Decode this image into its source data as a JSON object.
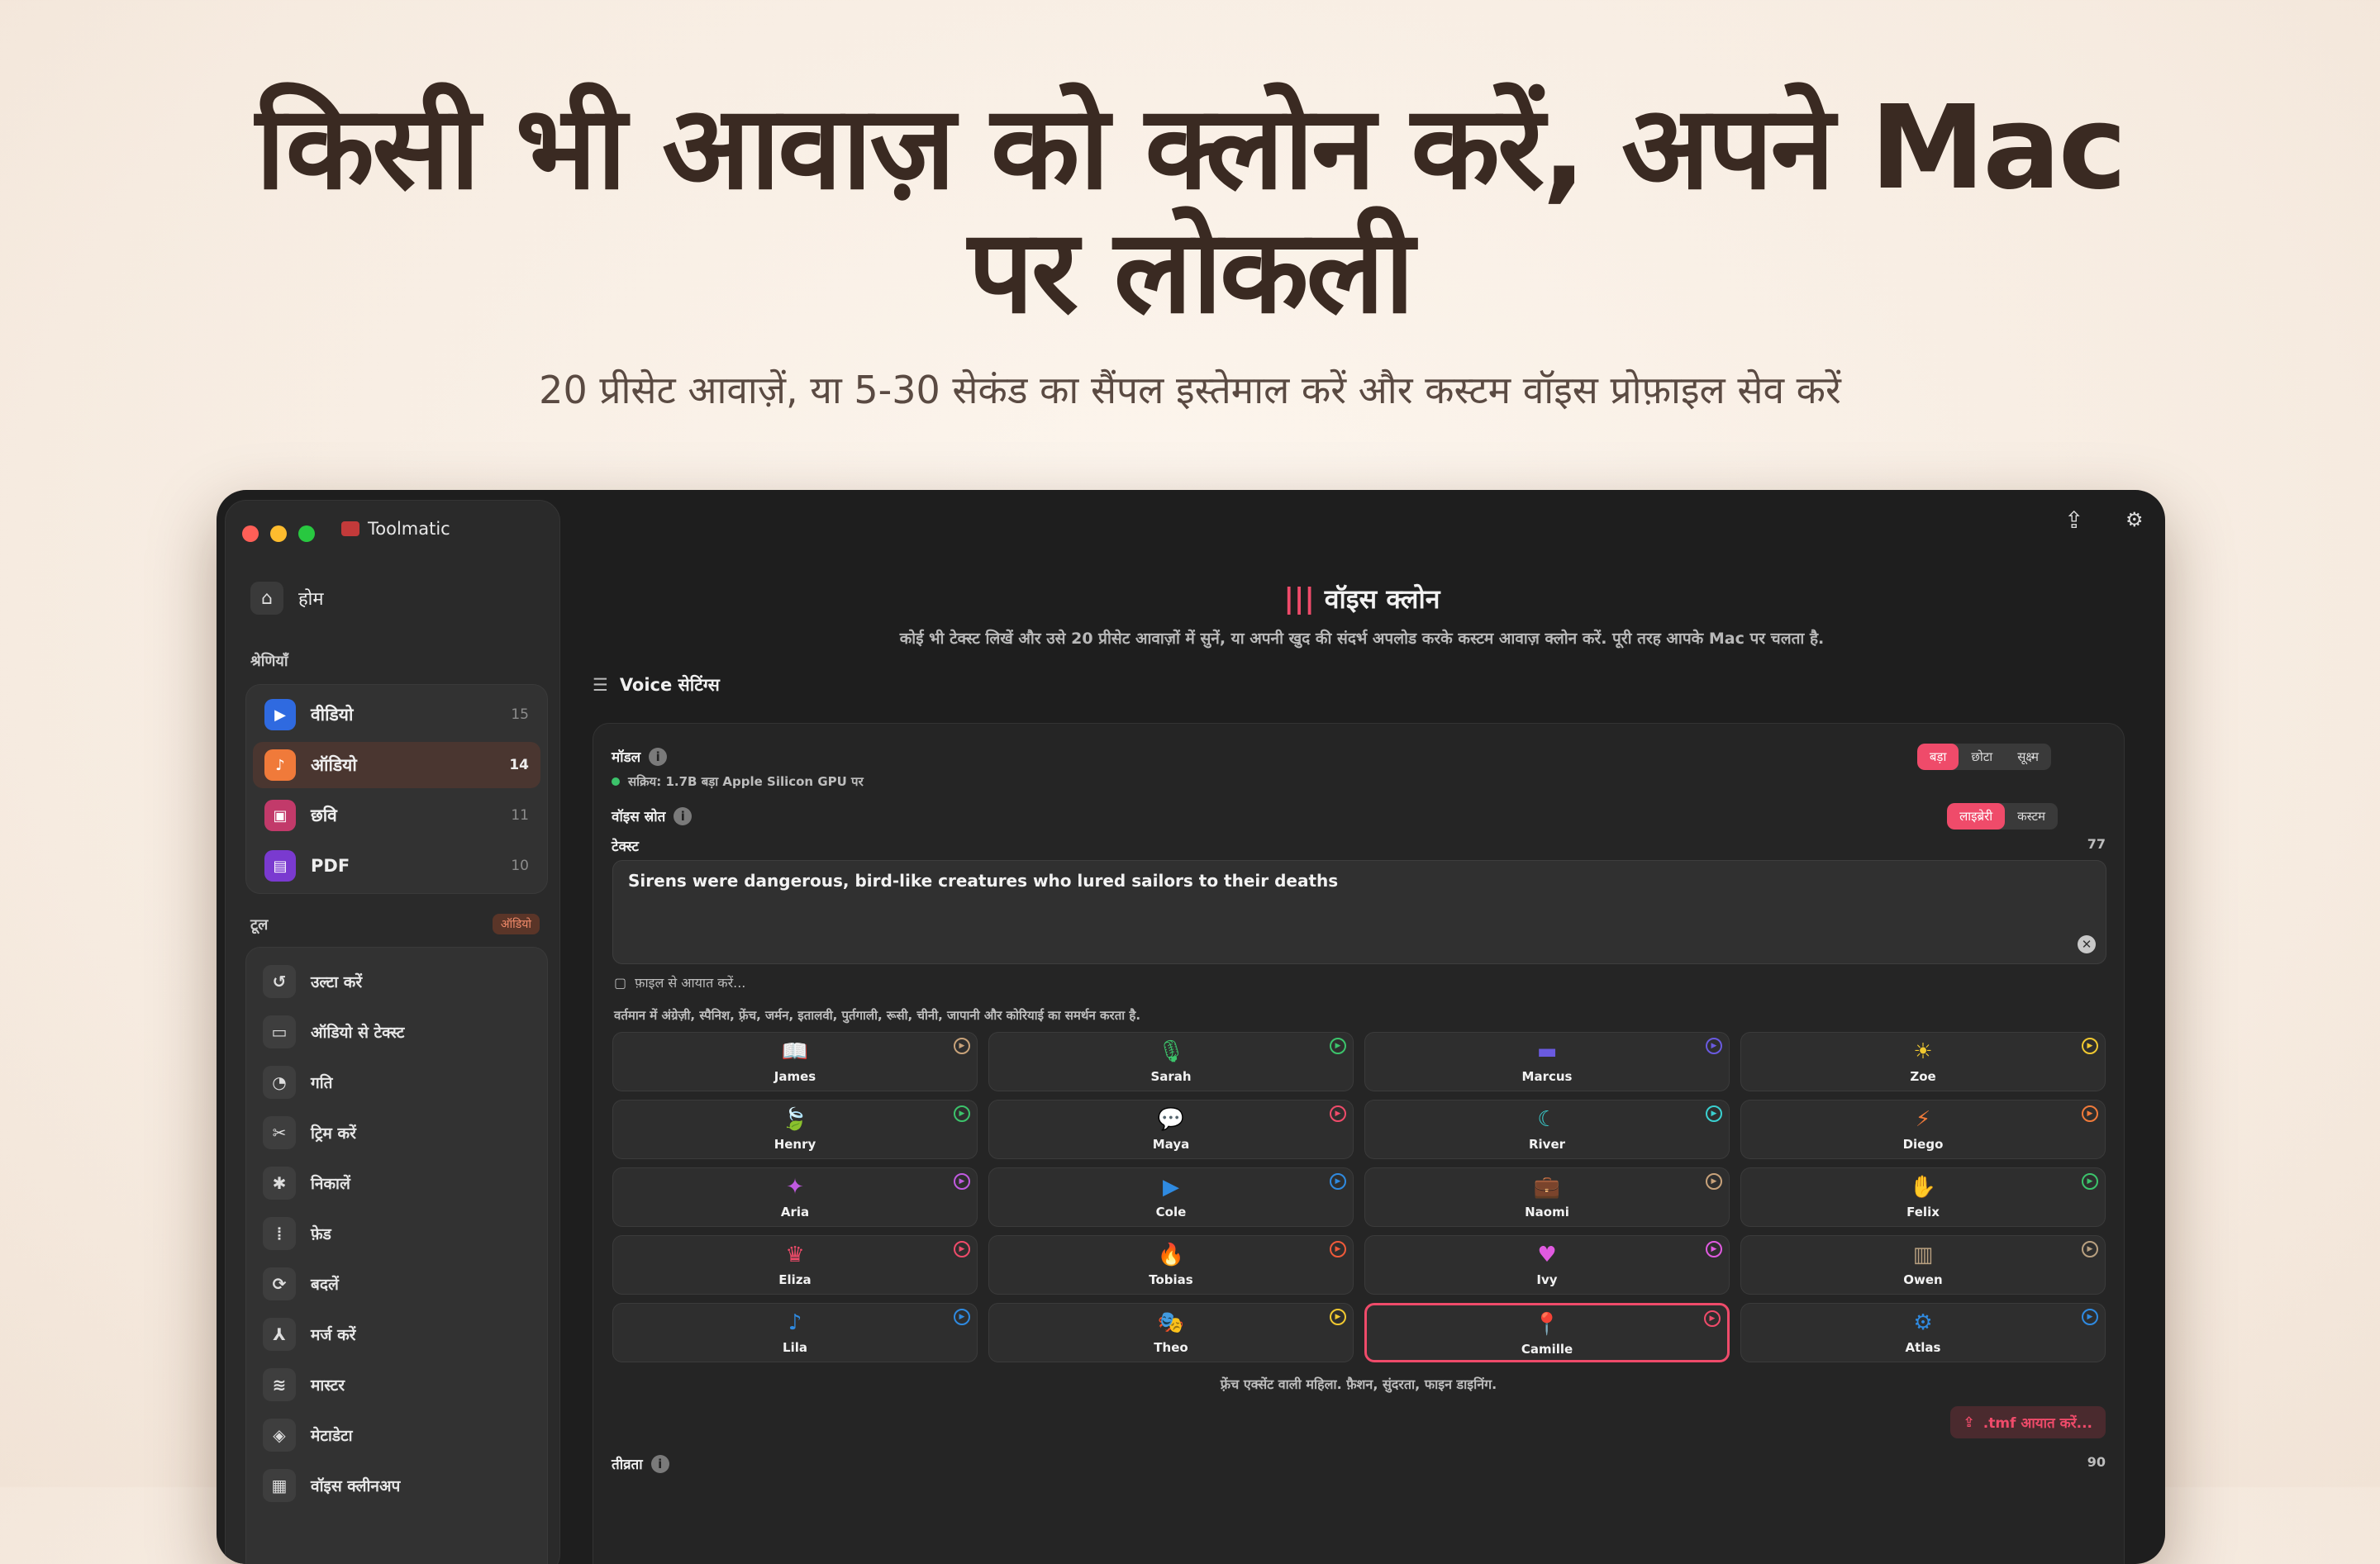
{
  "hero": {
    "title_line1": "किसी भी आवाज़ को क्लोन करें, अपने Mac",
    "title_line2": "पर लोकली",
    "subtitle": "20 प्रीसेट आवाज़ें, या 5-30 सेकंड का सैंपल इस्तेमाल करें और कस्टम वॉइस प्रोफ़ाइल सेव करें"
  },
  "app": {
    "title": "Toolmatic",
    "window_colors": {
      "close": "#ff5f57",
      "minimize": "#febc2e",
      "zoom": "#28c840"
    },
    "accent": "#ef4b6a"
  },
  "sidebar": {
    "home": "होम",
    "categories_label": "श्रेणियाँ",
    "categories": [
      {
        "label": "वीडियो",
        "count": "15",
        "icon": "video-icon",
        "color": "#2f6ae0"
      },
      {
        "label": "ऑडियो",
        "count": "14",
        "icon": "music-note-icon",
        "color": "#f07a3a"
      },
      {
        "label": "छवि",
        "count": "11",
        "icon": "image-icon",
        "color": "#c23a6a"
      },
      {
        "label": "PDF",
        "count": "10",
        "icon": "document-icon",
        "color": "#7a3ad0"
      }
    ],
    "tools_label": "टूल",
    "tools_badge": "ऑडियो",
    "tools": [
      {
        "label": "उल्टा करें",
        "icon": "undo-icon"
      },
      {
        "label": "ऑडियो से टेक्स्ट",
        "icon": "chat-bubble-icon"
      },
      {
        "label": "गति",
        "icon": "speedometer-icon"
      },
      {
        "label": "ट्रिम करें",
        "icon": "scissors-icon"
      },
      {
        "label": "निकालें",
        "icon": "waveform-extract-icon"
      },
      {
        "label": "फ़ेड",
        "icon": "waveform-fade-icon"
      },
      {
        "label": "बदलें",
        "icon": "convert-icon"
      },
      {
        "label": "मर्ज करें",
        "icon": "merge-icon"
      },
      {
        "label": "मास्टर",
        "icon": "master-icon"
      },
      {
        "label": "मेटाडेटा",
        "icon": "tag-icon"
      },
      {
        "label": "वॉइस क्लीनअप",
        "icon": "cleanup-icon"
      }
    ]
  },
  "main": {
    "title": "वॉइस क्लोन",
    "description": "कोई भी टेक्स्ट लिखें और उसे 20 प्रीसेट आवाज़ों में सुनें, या अपनी खुद की संदर्भ अपलोड करके कस्टम आवाज़ क्लोन करें. पूरी तरह आपके Mac पर चलता है.",
    "settings_title": "Voice सेटिंग्स",
    "model_label": "मॉडल",
    "model_status": "सक्रिय: 1.7B बड़ा Apple Silicon GPU पर",
    "model_options": [
      "बड़ा",
      "छोटा",
      "सूक्ष्म"
    ],
    "model_selected": "बड़ा",
    "source_label": "वॉइस स्रोत",
    "source_options": [
      "लाइब्रेरी",
      "कस्टम"
    ],
    "source_selected": "लाइब्रेरी",
    "text_label": "टेक्स्ट",
    "text_count": "77",
    "text_value": "Sirens were dangerous, bird-like creatures who lured sailors to their deaths",
    "import_file": "फ़ाइल से आयात करें...",
    "support_note": "वर्तमान में अंग्रेज़ी, स्पैनिश, फ़्रेंच, जर्मन, इतालवी, पुर्तगाली, रूसी, चीनी, जापानी और कोरियाई का समर्थन करता है.",
    "voices": [
      {
        "name": "James",
        "icon": "📖",
        "color": "#c8a27a"
      },
      {
        "name": "Sarah",
        "icon": "🎙",
        "color": "#3cc36b"
      },
      {
        "name": "Marcus",
        "icon": "▬",
        "color": "#6a5ae0"
      },
      {
        "name": "Zoe",
        "icon": "☀",
        "color": "#f0c830"
      },
      {
        "name": "Henry",
        "icon": "🍃",
        "color": "#3cc36b"
      },
      {
        "name": "Maya",
        "icon": "💬",
        "color": "#ef4b6a"
      },
      {
        "name": "River",
        "icon": "☾",
        "color": "#3ad0d0"
      },
      {
        "name": "Diego",
        "icon": "⚡",
        "color": "#f07a3a"
      },
      {
        "name": "Aria",
        "icon": "✦",
        "color": "#c05ae0"
      },
      {
        "name": "Cole",
        "icon": "▶",
        "color": "#2f8ae0"
      },
      {
        "name": "Naomi",
        "icon": "💼",
        "color": "#c8a27a"
      },
      {
        "name": "Felix",
        "icon": "✋",
        "color": "#3cc36b"
      },
      {
        "name": "Eliza",
        "icon": "♛",
        "color": "#ef4b6a"
      },
      {
        "name": "Tobias",
        "icon": "🔥",
        "color": "#ef5a3a"
      },
      {
        "name": "Ivy",
        "icon": "♥",
        "color": "#e05ae0"
      },
      {
        "name": "Owen",
        "icon": "▥",
        "color": "#b8a080"
      },
      {
        "name": "Lila",
        "icon": "♪",
        "color": "#2f8ae0"
      },
      {
        "name": "Theo",
        "icon": "🎭",
        "color": "#f0c830"
      },
      {
        "name": "Camille",
        "icon": "📍",
        "color": "#ef4b6a"
      },
      {
        "name": "Atlas",
        "icon": "⚙",
        "color": "#2f8ae0"
      }
    ],
    "selected_voice": "Camille",
    "selected_desc": "फ़्रेंच एक्सेंट वाली महिला. फ़ैशन, सुंदरता, फाइन डाइनिंग.",
    "tmf_import": ".tmf आयात करें...",
    "intensity_label": "तीव्रता",
    "intensity_value": "90"
  }
}
